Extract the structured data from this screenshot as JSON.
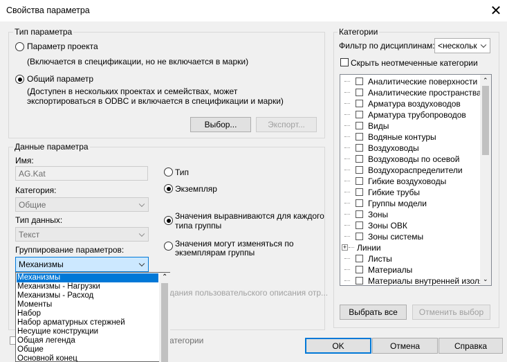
{
  "window": {
    "title": "Свойства параметра"
  },
  "param_type": {
    "group_label": "Тип параметра",
    "project_param_label": "Параметр проекта",
    "project_param_desc": "(Включается в спецификации, но не включается в марки)",
    "shared_param_label": "Общий параметр",
    "shared_param_desc_line1": "(Доступен в нескольких проектах и семействах, может",
    "shared_param_desc_line2": "экспортироваться в ODBC и включается в спецификации и марки)",
    "select_button": "Выбор...",
    "export_button": "Экспорт..."
  },
  "param_data": {
    "group_label": "Данные параметра",
    "name_label": "Имя:",
    "name_value": "AG.Kat",
    "category_label": "Категория:",
    "category_value": "Общие",
    "datatype_label": "Тип данных:",
    "datatype_value": "Текст",
    "grouping_label": "Группирование параметров:",
    "grouping_value": "Механизмы",
    "type_radio": "Тип",
    "instance_radio": "Экземпляр",
    "aligned_line1": "Значения выравниваются для каждого",
    "aligned_line2": "типа группы",
    "vary_line1": "Значения могут изменяться по",
    "vary_line2": "экземплярам группы",
    "tooltip_text": "дания пользовательского описания отр...",
    "add_to_all_text": "атегории"
  },
  "grouping_dropdown": {
    "options": [
      "Механизмы",
      "Механизмы - Нагрузки",
      "Механизмы - Расход",
      "Моменты",
      "Набор",
      "Набор арматурных стержней",
      "Несущие конструкции",
      "Общая легенда",
      "Общие",
      "Основной конец"
    ],
    "selected_index": 0
  },
  "categories": {
    "group_label": "Категории",
    "filter_label": "Фильтр по дисциплинам:",
    "filter_value": "<нескольк",
    "hide_unchecked_label": "Скрыть неотмеченные категории",
    "items": [
      "Аналитические поверхности",
      "Аналитические пространства",
      "Арматура воздуховодов",
      "Арматура трубопроводов",
      "Виды",
      "Водяные контуры",
      "Воздуховоды",
      "Воздуховоды по осевой",
      "Воздухораспределители",
      "Гибкие воздуховоды",
      "Гибкие трубы",
      "Группы модели",
      "Зоны",
      "Зоны ОВК",
      "Зоны системы",
      "Линии",
      "Листы",
      "Материалы",
      "Материалы внутренней изоляции"
    ],
    "select_all_button": "Выбрать все",
    "deselect_button": "Отменить выбор"
  },
  "footer": {
    "ok": "OK",
    "cancel": "Отмена",
    "help": "Справка"
  }
}
